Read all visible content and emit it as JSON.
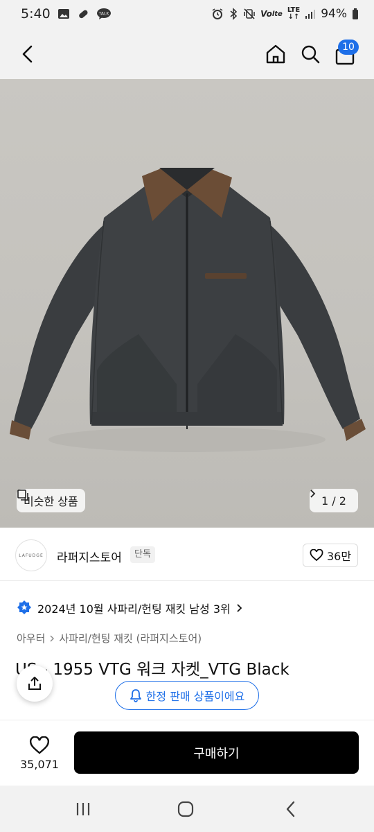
{
  "status_bar": {
    "time": "5:40",
    "lte": "LTE",
    "volte": "Vo",
    "battery": "94%",
    "left_icons": [
      "gallery-icon",
      "link-icon",
      "talk-icon"
    ],
    "right_icons": [
      "alarm-icon",
      "bluetooth-icon",
      "vibrate-icon",
      "volte-icon",
      "lte-icon",
      "signal-icon",
      "battery-icon"
    ],
    "talk_label": "TALK"
  },
  "app_bar": {
    "back_icon": "back-arrow-icon",
    "home_icon": "home-icon",
    "search_icon": "search-icon",
    "cart_icon": "shopping-bag-icon",
    "cart_count": "10"
  },
  "gallery": {
    "similar_label": "비슷한 상품",
    "pager_text": "1 / 2",
    "image_subject": "jacket-product-photo"
  },
  "store": {
    "logo_text": "LAFUDGE",
    "name": "라퍼지스토어",
    "badge": "단독",
    "likes": "36만"
  },
  "ranking": {
    "text": "2024년 10월 사파리/헌팅 재킷 남성 3위"
  },
  "category": {
    "parent": "아우터",
    "child": "사파리/헌팅 재킷 (라퍼지스토어)"
  },
  "product": {
    "title": "US - 1955 VTG 워크 자켓_VTG Black"
  },
  "notice": {
    "limited_label": "한정 판매 상품이에요"
  },
  "bottom_bar": {
    "like_count": "35,071",
    "buy_label": "구매하기"
  },
  "colors": {
    "accent": "#1e6fe8",
    "buy_button": "#000000",
    "background": "#ffffff"
  }
}
